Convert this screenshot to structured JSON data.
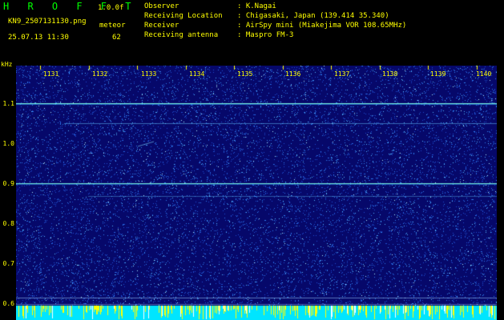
{
  "header": {
    "app_name": "H R O F F T",
    "version": "1.0.0f",
    "filename": "KN9_2507131130.png",
    "mode": "meteor",
    "timestamp": "25.07.13 11:30",
    "count": "62",
    "info": [
      {
        "label": "Observer",
        "value": ": K.Nagai"
      },
      {
        "label": "Receiving Location",
        "value": ": Chigasaki, Japan (139.414 35.340)"
      },
      {
        "label": "Receiver",
        "value": ": AirSpy mini (Miakejima VOR 108.65MHz)"
      },
      {
        "label": "Receiving antenna",
        "value": ": Maspro FM-3"
      }
    ]
  },
  "plot": {
    "y_unit": "kHz",
    "y_ticks": [
      "1.1",
      "1.0",
      "0.9",
      "0.8",
      "0.7",
      "0.6"
    ],
    "x_ticks": [
      "1131",
      "1132",
      "1133",
      "1134",
      "1135",
      "1136",
      "1137",
      "1138",
      "1139",
      "1140"
    ],
    "colors": {
      "background": "#06086a",
      "noise": "#3aa0ff",
      "carrier": "#7fffe0",
      "bottom_band": "#00e5ff",
      "marker": "#ffff00"
    }
  }
}
